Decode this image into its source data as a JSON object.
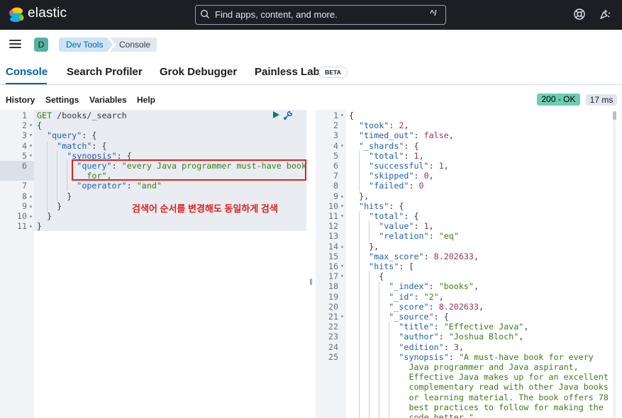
{
  "app": {
    "logo_text": "elastic",
    "logo_icon": "elastic-cluster-logo"
  },
  "search": {
    "placeholder": "Find apps, content, and more.",
    "shortcut": "^/"
  },
  "header_icons": [
    "help-lifebuoy-icon",
    "whats-new-icon"
  ],
  "breadcrumb": {
    "avatar": "D",
    "items": [
      "Dev Tools",
      "Console"
    ]
  },
  "tabs": [
    {
      "label": "Console",
      "active": true
    },
    {
      "label": "Search Profiler"
    },
    {
      "label": "Grok Debugger"
    },
    {
      "label": "Painless Lab",
      "badge": "BETA"
    }
  ],
  "menu": [
    "History",
    "Settings",
    "Variables",
    "Help"
  ],
  "status": {
    "code": "200 - OK",
    "time": "17 ms"
  },
  "request": {
    "lines": [
      {
        "n": "1",
        "fold": "",
        "text": "GET /books/_search"
      },
      {
        "n": "2",
        "fold": "▾",
        "text": "{"
      },
      {
        "n": "3",
        "fold": "▾",
        "text": "  \"query\": {"
      },
      {
        "n": "4",
        "fold": "▾",
        "text": "    \"match\": {"
      },
      {
        "n": "5",
        "fold": "▾",
        "text": "      \"synopsis\": {"
      },
      {
        "n": "6",
        "fold": "",
        "text": "        \"query\": \"every Java programmer must-have book",
        "cont": [
          "          for\","
        ]
      },
      {
        "n": "7",
        "fold": "",
        "text": "        \"operator\": \"and\""
      },
      {
        "n": "8",
        "fold": "▴",
        "text": "      }"
      },
      {
        "n": "9",
        "fold": "▴",
        "text": "    }"
      },
      {
        "n": "10",
        "fold": "▴",
        "text": "  }"
      },
      {
        "n": "11",
        "fold": "▴",
        "text": "}"
      }
    ]
  },
  "response": {
    "lines": [
      {
        "n": "1",
        "fold": "▾",
        "text": "{"
      },
      {
        "n": "2",
        "fold": "",
        "text": "  \"took\": 2,"
      },
      {
        "n": "3",
        "fold": "",
        "text": "  \"timed_out\": false,"
      },
      {
        "n": "4",
        "fold": "▾",
        "text": "  \"_shards\": {"
      },
      {
        "n": "5",
        "fold": "",
        "text": "    \"total\": 1,"
      },
      {
        "n": "6",
        "fold": "",
        "text": "    \"successful\": 1,"
      },
      {
        "n": "7",
        "fold": "",
        "text": "    \"skipped\": 0,"
      },
      {
        "n": "8",
        "fold": "",
        "text": "    \"failed\": 0"
      },
      {
        "n": "9",
        "fold": "▴",
        "text": "  },"
      },
      {
        "n": "10",
        "fold": "▾",
        "text": "  \"hits\": {"
      },
      {
        "n": "11",
        "fold": "▾",
        "text": "    \"total\": {"
      },
      {
        "n": "12",
        "fold": "",
        "text": "      \"value\": 1,"
      },
      {
        "n": "13",
        "fold": "",
        "text": "      \"relation\": \"eq\""
      },
      {
        "n": "14",
        "fold": "▴",
        "text": "    },"
      },
      {
        "n": "15",
        "fold": "",
        "text": "    \"max_score\": 8.202633,"
      },
      {
        "n": "16",
        "fold": "▾",
        "text": "    \"hits\": ["
      },
      {
        "n": "17",
        "fold": "▾",
        "text": "      {"
      },
      {
        "n": "18",
        "fold": "",
        "text": "        \"_index\": \"books\","
      },
      {
        "n": "19",
        "fold": "",
        "text": "        \"_id\": \"2\","
      },
      {
        "n": "20",
        "fold": "",
        "text": "        \"_score\": 8.202633,"
      },
      {
        "n": "21",
        "fold": "▾",
        "text": "        \"_source\": {"
      },
      {
        "n": "22",
        "fold": "",
        "text": "          \"title\": \"Effective Java\","
      },
      {
        "n": "23",
        "fold": "",
        "text": "          \"author\": \"Joshua Bloch\","
      },
      {
        "n": "24",
        "fold": "",
        "text": "          \"edition\": 3,"
      },
      {
        "n": "25",
        "fold": "",
        "text": "          \"synopsis\": \"A must-have book for every",
        "cont": [
          "            Java programmer and Java aspirant,",
          "            Effective Java makes up for an excellent",
          "            complementary read with other Java books",
          "            or learning material. The book offers 78",
          "            best practices to follow for making the",
          "            code better.\""
        ]
      }
    ]
  },
  "annotation": {
    "text": "검색어 순서를 변경해도 동일하게 검색"
  },
  "colors": {
    "header_bg": "#1d1e24",
    "accent": "#0061a6",
    "status_ok": "#6dccb1",
    "annotation_red": "#e0201f",
    "code_key": "#1f5fa8",
    "code_string": "#3b7d17",
    "code_number": "#a33058",
    "code_plain": "#343741"
  }
}
